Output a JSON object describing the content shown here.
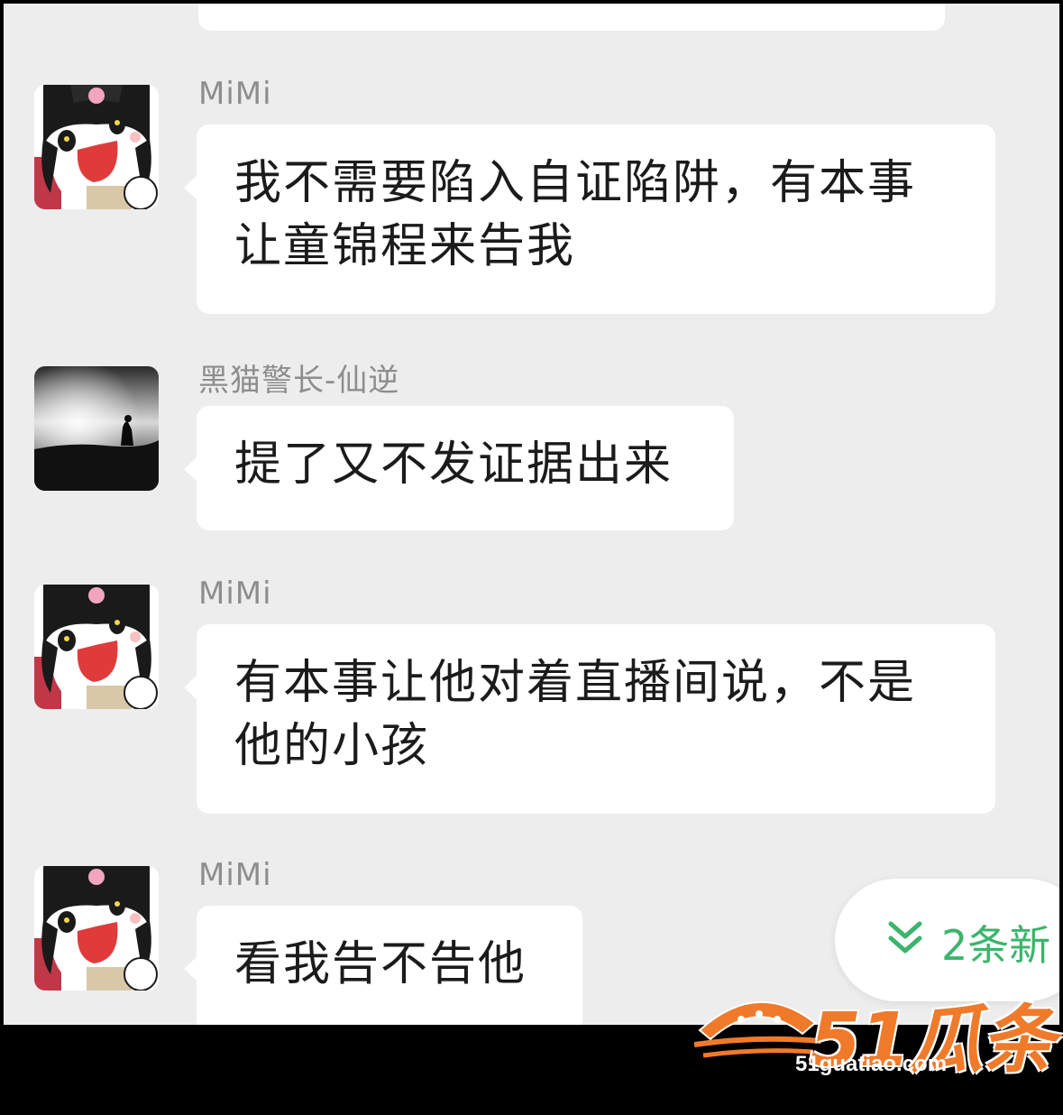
{
  "messages": [
    {
      "sender": "MiMi",
      "avatar": "anime-girl-avatar",
      "lines": [
        "我不需要陷入自证陷阱，有本事",
        "让童锦程来告我"
      ]
    },
    {
      "sender": "黑猫警长-仙逆",
      "avatar": "silhouette-avatar",
      "lines": [
        "提了又不发证据出来"
      ]
    },
    {
      "sender": "MiMi",
      "avatar": "anime-girl-avatar",
      "lines": [
        "有本事让他对着直播间说，不是",
        "他的小孩"
      ]
    },
    {
      "sender": "MiMi",
      "avatar": "anime-girl-avatar",
      "lines": [
        "看我告不告他"
      ]
    }
  ],
  "new_messages_indicator": {
    "label": "2条新"
  },
  "watermark": {
    "brand": "51瓜条",
    "url": "51guatiao.com"
  },
  "colors": {
    "background": "#ededed",
    "bubble": "#ffffff",
    "accent_green": "#3cb46b",
    "watermark_orange": "#f07a2a"
  }
}
